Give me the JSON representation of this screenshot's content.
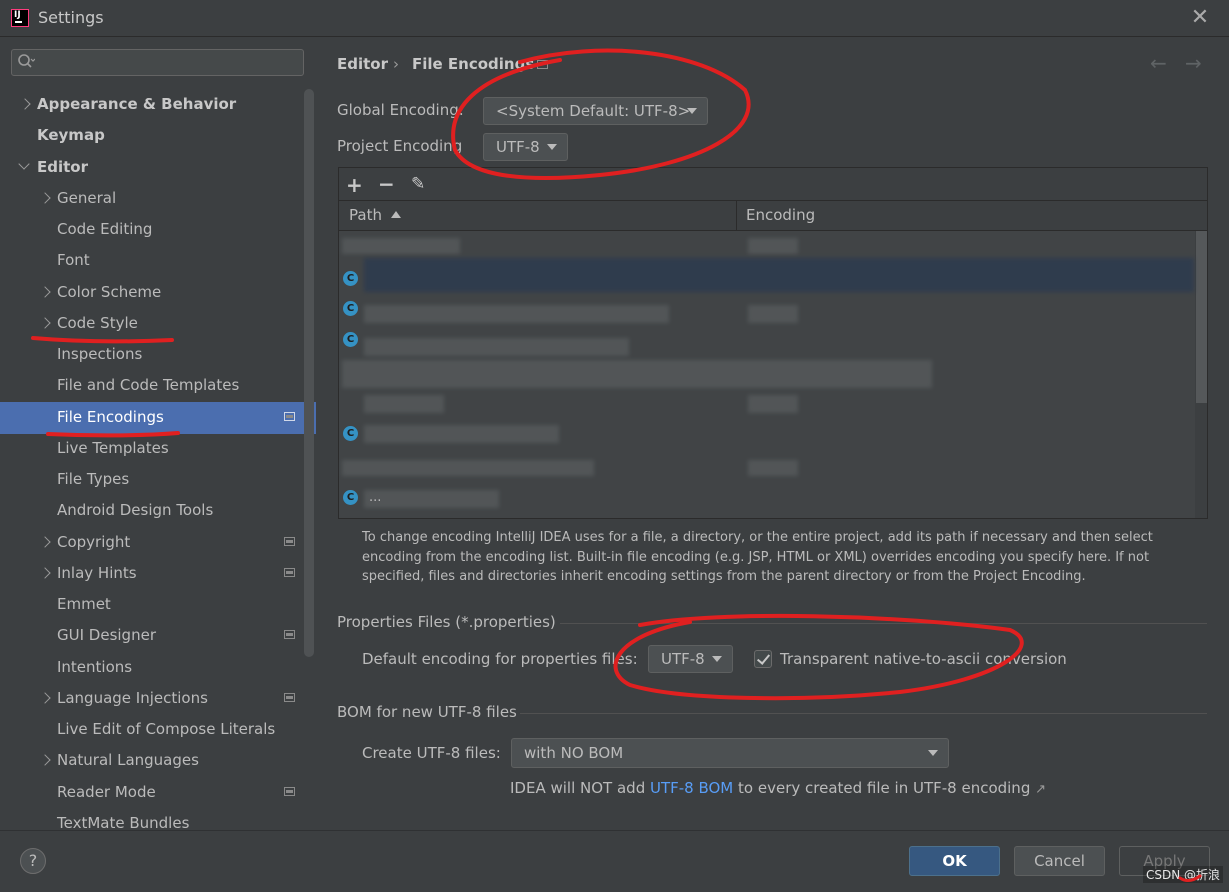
{
  "window": {
    "title": "Settings"
  },
  "sidebar": {
    "items": [
      {
        "label": "Appearance & Behavior"
      },
      {
        "label": "Keymap"
      },
      {
        "label": "Editor"
      },
      {
        "label": "General"
      },
      {
        "label": "Code Editing"
      },
      {
        "label": "Font"
      },
      {
        "label": "Color Scheme"
      },
      {
        "label": "Code Style"
      },
      {
        "label": "Inspections"
      },
      {
        "label": "File and Code Templates"
      },
      {
        "label": "File Encodings"
      },
      {
        "label": "Live Templates"
      },
      {
        "label": "File Types"
      },
      {
        "label": "Android Design Tools"
      },
      {
        "label": "Copyright"
      },
      {
        "label": "Inlay Hints"
      },
      {
        "label": "Emmet"
      },
      {
        "label": "GUI Designer"
      },
      {
        "label": "Intentions"
      },
      {
        "label": "Language Injections"
      },
      {
        "label": "Live Edit of Compose Literals"
      },
      {
        "label": "Natural Languages"
      },
      {
        "label": "Reader Mode"
      },
      {
        "label": "TextMate Bundles"
      }
    ]
  },
  "breadcrumb": {
    "parent": "Editor",
    "separator": "›",
    "current": "File Encodings"
  },
  "encoding": {
    "global_label": "Global Encoding:",
    "global_value": "<System Default: UTF-8>",
    "project_label": "Project Encoding",
    "project_value": "UTF-8"
  },
  "table": {
    "columns": [
      "Path",
      "Encoding"
    ],
    "toolbar": {
      "add": "+",
      "remove": "−",
      "edit": "✎"
    },
    "visible_fragment": "..."
  },
  "help_text": "To change encoding IntelliJ IDEA uses for a file, a directory, or the entire project, add its path if necessary and then select encoding from the encoding list. Built-in file encoding (e.g. JSP, HTML or XML) overrides encoding you specify here. If not specified, files and directories inherit encoding settings from the parent directory or from the Project Encoding.",
  "properties": {
    "section": "Properties Files (*.properties)",
    "default_label": "Default encoding for properties files:",
    "default_value": "UTF-8",
    "native_checkbox_label": "Transparent native-to-ascii conversion",
    "native_checked": true
  },
  "bom": {
    "section": "BOM for new UTF-8 files",
    "create_label": "Create UTF-8 files:",
    "create_value": "with NO BOM",
    "note_prefix": "IDEA will NOT add ",
    "note_link": "UTF-8 BOM",
    "note_suffix": " to every created file in UTF-8 encoding",
    "note_arrow": "↗"
  },
  "footer": {
    "help": "?",
    "ok": "OK",
    "cancel": "Cancel",
    "apply": "Apply",
    "watermark": "CSDN @折浪"
  },
  "colors": {
    "background": "#3c3f41",
    "selection": "#4b6eaf",
    "ok_button": "#365880",
    "link": "#589df6"
  }
}
